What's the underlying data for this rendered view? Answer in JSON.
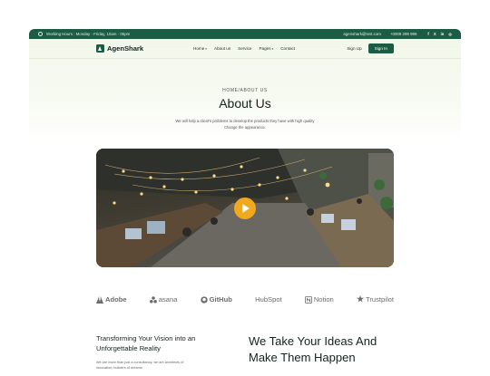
{
  "topbar": {
    "working_hours": "Working Hours : Monday - Friday, 10am - 05pm",
    "email": "agenshark@test.com",
    "phone": "+0009 299 999",
    "socials": [
      "f",
      "X",
      "in",
      "◎"
    ]
  },
  "nav": {
    "brand": "AgenShark",
    "menu": [
      "Home",
      "About us",
      "Service",
      "Pages",
      "Contact"
    ],
    "sign_up": "Sign Up",
    "sign_in": "Sign In"
  },
  "hero": {
    "breadcrumb": "HOME/ABOUT US",
    "title": "About Us",
    "subtitle": "We will help a client's problems to develop the products they have with high quality Change the appearance."
  },
  "video": {
    "play_icon": "play-icon",
    "accent": "#f0a91f"
  },
  "partners": [
    "Adobe",
    "asana",
    "GitHub",
    "HubSpot",
    "Notion",
    "Trustpilot"
  ],
  "section": {
    "left_title": "Transforming Your Vision into an Unforgettable Reality",
    "left_text": "We are more than just a consultancy, we are architects of innovation, builders of dreams.",
    "right_title": "We Take Your Ideas And Make Them Happen"
  },
  "colors": {
    "primary": "#1d5c44",
    "accent": "#f0a91f"
  }
}
